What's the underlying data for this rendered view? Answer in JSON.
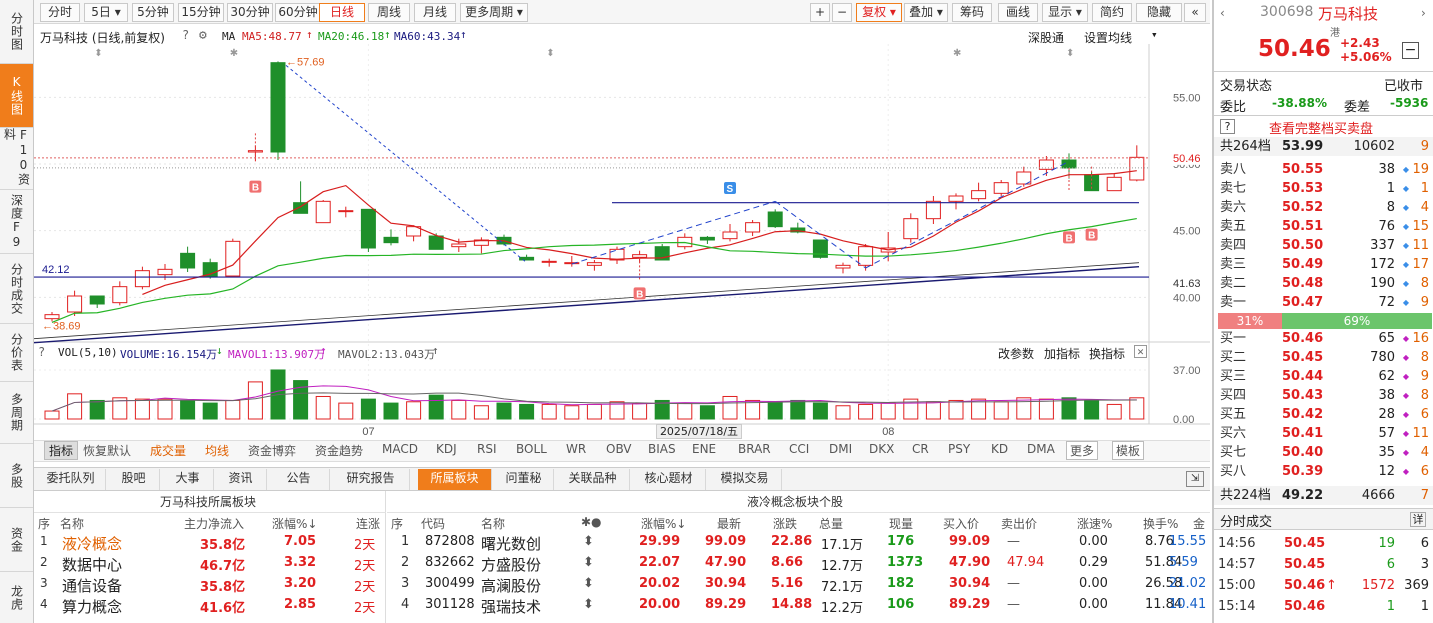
{
  "left_sidebar": [
    "分时图",
    "K线图",
    "F10资料",
    "深度F9",
    "分时成交",
    "分价表",
    "多周期",
    "多股",
    "资金",
    "龙虎"
  ],
  "toolbar": {
    "periods": [
      "分时",
      "5日",
      "5分钟",
      "15分钟",
      "30分钟",
      "60分钟",
      "日线",
      "周线",
      "月线",
      "更多周期"
    ],
    "active_period": "日线",
    "right_buttons": [
      "+",
      "−",
      "复权",
      "叠加",
      "筹码",
      "画线",
      "显示",
      "简约",
      "隐藏",
      "«"
    ]
  },
  "chart_header": {
    "title": "万马科技 (日线,前复权)",
    "ma_label": "MA",
    "ma5": "MA5:48.77",
    "ma20": "MA20:46.18",
    "ma60": "MA60:43.34",
    "shengutong": "深股通",
    "setting": "设置均线"
  },
  "price_labels": {
    "high": "57.69",
    "low": "38.69",
    "ref_line": "42.12",
    "cur": "50.46",
    "right_level": "41.63"
  },
  "volume_header": {
    "title": "VOL(5,10)",
    "volume": "VOLUME:16.154万",
    "mavol1": "MAVOL1:13.907万",
    "mavol2": "MAVOL2:13.043万",
    "change_params": "改参数",
    "add_indicator": "加指标",
    "swap_indicator": "换指标"
  },
  "x_axis": {
    "date": "2025/07/18/五"
  },
  "indicator_tabs": [
    "指标",
    "恢复默认",
    "成交量",
    "均线",
    "资金博弈",
    "资金趋势",
    "MACD",
    "KDJ",
    "RSI",
    "BOLL",
    "WR",
    "OBV",
    "BIAS",
    "ENE",
    "BRAR",
    "CCI",
    "DMI",
    "DKX",
    "CR",
    "PSY",
    "KD",
    "DMA",
    "更多",
    "模板"
  ],
  "bottom_tabs": [
    "委托队列",
    "股吧",
    "大事",
    "资讯",
    "公告",
    "研究报告",
    "所属板块",
    "问董秘",
    "关联品种",
    "核心题材",
    "模拟交易"
  ],
  "active_bottom_tab": "所属板块",
  "sectors": {
    "title": "万马科技所属板块",
    "headers": [
      "序",
      "名称",
      "主力净流入",
      "涨幅%↓",
      "连涨"
    ],
    "rows": [
      [
        "1",
        "液冷概念",
        "35.8亿",
        "7.05",
        "2天"
      ],
      [
        "2",
        "数据中心",
        "46.7亿",
        "3.32",
        "2天"
      ],
      [
        "3",
        "通信设备",
        "35.8亿",
        "3.20",
        "2天"
      ],
      [
        "4",
        "算力概念",
        "41.6亿",
        "2.85",
        "2天"
      ]
    ]
  },
  "stocks": {
    "title": "液冷概念板块个股",
    "headers": [
      "序",
      "代码",
      "名称",
      "✱●",
      "涨幅%↓",
      "最新",
      "涨跌",
      "总量",
      "现量",
      "买入价",
      "卖出价",
      "涨速%",
      "换手%",
      "金"
    ],
    "rows": [
      [
        "1",
        "872808",
        "曙光数创",
        "⬍",
        "29.99",
        "99.09",
        "22.86",
        "17.1万",
        "176",
        "99.09",
        "—",
        "0.00",
        "8.76",
        "15.55"
      ],
      [
        "2",
        "832662",
        "方盛股份",
        "⬍",
        "22.07",
        "47.90",
        "8.66",
        "12.7万",
        "1373",
        "47.90",
        "47.94",
        "0.29",
        "51.84",
        "5.59"
      ],
      [
        "3",
        "300499",
        "高澜股份",
        "⬍",
        "20.02",
        "30.94",
        "5.16",
        "72.1万",
        "182",
        "30.94",
        "—",
        "0.00",
        "26.58",
        "21.02"
      ],
      [
        "4",
        "301128",
        "强瑞技术",
        "⬍",
        "20.00",
        "89.29",
        "14.88",
        "12.2万",
        "106",
        "89.29",
        "—",
        "0.00",
        "11.84",
        "10.41"
      ]
    ]
  },
  "quote": {
    "code": "300698",
    "name": "万马科技",
    "market_tag": "港",
    "price": "50.46",
    "change": "+2.43",
    "change_pct": "+5.06%",
    "status_label": "交易状态",
    "status": "已收市",
    "weibi_label": "委比",
    "weibi": "-38.88%",
    "weicha_label": "委差",
    "weicha": "-5936",
    "full_book": "查看完整档买卖盘",
    "sell_total": [
      "共264档",
      "53.99",
      "10602",
      "9"
    ],
    "asks": [
      [
        "卖八",
        "50.55",
        "38",
        "19"
      ],
      [
        "卖七",
        "50.53",
        "1",
        "1"
      ],
      [
        "卖六",
        "50.52",
        "8",
        "4"
      ],
      [
        "卖五",
        "50.51",
        "76",
        "15"
      ],
      [
        "卖四",
        "50.50",
        "337",
        "11"
      ],
      [
        "卖三",
        "50.49",
        "172",
        "17"
      ],
      [
        "卖二",
        "50.48",
        "190",
        "8"
      ],
      [
        "卖一",
        "50.47",
        "72",
        "9"
      ]
    ],
    "ratio_sell": "31%",
    "ratio_buy": "69%",
    "bids": [
      [
        "买一",
        "50.46",
        "65",
        "16"
      ],
      [
        "买二",
        "50.45",
        "780",
        "8"
      ],
      [
        "买三",
        "50.44",
        "62",
        "9"
      ],
      [
        "买四",
        "50.43",
        "38",
        "8"
      ],
      [
        "买五",
        "50.42",
        "28",
        "6"
      ],
      [
        "买六",
        "50.41",
        "57",
        "11"
      ],
      [
        "买七",
        "50.40",
        "35",
        "4"
      ],
      [
        "买八",
        "50.39",
        "12",
        "6"
      ]
    ],
    "buy_total": [
      "共224档",
      "49.22",
      "4666",
      "7"
    ],
    "ticks_title": "分时成交",
    "ticks_more": "详",
    "ticks": [
      [
        "14:56",
        "50.45",
        "19",
        "6"
      ],
      [
        "14:57",
        "50.45",
        "6",
        "3"
      ],
      [
        "15:00",
        "50.46",
        "1572",
        "369"
      ],
      [
        "15:14",
        "50.46",
        "1",
        "1"
      ]
    ]
  },
  "chart_data": {
    "type": "candlestick",
    "y_ticks": [
      "55.00",
      "50.00",
      "45.00",
      "40.00"
    ],
    "vol_ticks": [
      "37.00",
      "0.00"
    ],
    "x_ticks": [
      "07",
      "08"
    ],
    "candles": [
      [
        38.4,
        38.9,
        38.2,
        38.7
      ],
      [
        38.9,
        40.5,
        38.6,
        40.1
      ],
      [
        40.1,
        40.1,
        39.2,
        39.5
      ],
      [
        39.6,
        41.2,
        39.4,
        40.8
      ],
      [
        40.8,
        42.3,
        40.6,
        42.0
      ],
      [
        41.7,
        42.5,
        41.3,
        42.1
      ],
      [
        43.3,
        43.8,
        41.9,
        42.2
      ],
      [
        42.6,
        42.9,
        41.4,
        41.6
      ],
      [
        41.6,
        44.4,
        41.5,
        44.2
      ],
      [
        50.9,
        51.4,
        50.2,
        51.0
      ],
      [
        57.6,
        57.7,
        50.3,
        50.9
      ],
      [
        47.1,
        48.7,
        46.3,
        46.3
      ],
      [
        45.6,
        47.3,
        45.6,
        47.2
      ],
      [
        46.5,
        46.8,
        46.0,
        46.5
      ],
      [
        46.6,
        46.6,
        43.4,
        43.7
      ],
      [
        44.5,
        45.1,
        43.9,
        44.1
      ],
      [
        44.6,
        45.4,
        44.2,
        45.3
      ],
      [
        44.6,
        44.8,
        43.6,
        43.6
      ],
      [
        43.8,
        44.4,
        43.4,
        44.0
      ],
      [
        43.9,
        44.5,
        43.3,
        44.3
      ],
      [
        44.5,
        44.7,
        43.9,
        44.0
      ],
      [
        43.0,
        43.2,
        42.8,
        42.8
      ],
      [
        42.7,
        42.9,
        42.3,
        42.7
      ],
      [
        42.6,
        43.1,
        42.3,
        42.6
      ],
      [
        42.4,
        42.8,
        42.0,
        42.6
      ],
      [
        42.8,
        43.8,
        42.5,
        43.6
      ],
      [
        43.0,
        43.5,
        42.6,
        43.2
      ],
      [
        43.8,
        44.0,
        42.8,
        42.8
      ],
      [
        43.8,
        44.8,
        43.6,
        44.5
      ],
      [
        44.5,
        44.6,
        44.0,
        44.3
      ],
      [
        44.4,
        45.5,
        44.2,
        44.9
      ],
      [
        44.9,
        45.8,
        44.6,
        45.6
      ],
      [
        46.4,
        46.6,
        45.2,
        45.3
      ],
      [
        45.2,
        45.6,
        44.8,
        44.9
      ],
      [
        44.3,
        44.3,
        42.9,
        43.0
      ],
      [
        42.2,
        42.6,
        41.8,
        42.4
      ],
      [
        42.4,
        44.0,
        42.0,
        43.8
      ],
      [
        43.4,
        44.9,
        42.7,
        43.7
      ],
      [
        44.4,
        46.3,
        44.1,
        45.9
      ],
      [
        45.9,
        47.6,
        45.5,
        47.2
      ],
      [
        47.2,
        47.8,
        46.6,
        47.6
      ],
      [
        47.4,
        48.6,
        47.2,
        48.0
      ],
      [
        47.8,
        48.8,
        47.6,
        48.6
      ],
      [
        48.5,
        49.8,
        48.3,
        49.4
      ],
      [
        49.6,
        50.6,
        49.1,
        50.3
      ],
      [
        50.3,
        50.8,
        48.9,
        49.7
      ],
      [
        49.2,
        49.4,
        48.0,
        48.0
      ],
      [
        48.0,
        49.3,
        48.0,
        49.0
      ],
      [
        48.8,
        51.4,
        48.7,
        50.5
      ]
    ],
    "volumes": [
      6,
      19,
      14,
      16,
      15,
      15,
      14,
      12,
      14,
      28,
      37,
      29,
      17,
      12,
      15,
      12,
      13,
      18,
      14,
      10,
      12,
      11,
      11,
      10,
      11,
      13,
      12,
      14,
      12,
      10,
      17,
      14,
      13,
      14,
      12,
      10,
      11,
      12,
      15,
      13,
      14,
      15,
      13,
      16,
      15,
      16,
      14,
      11,
      16
    ]
  }
}
